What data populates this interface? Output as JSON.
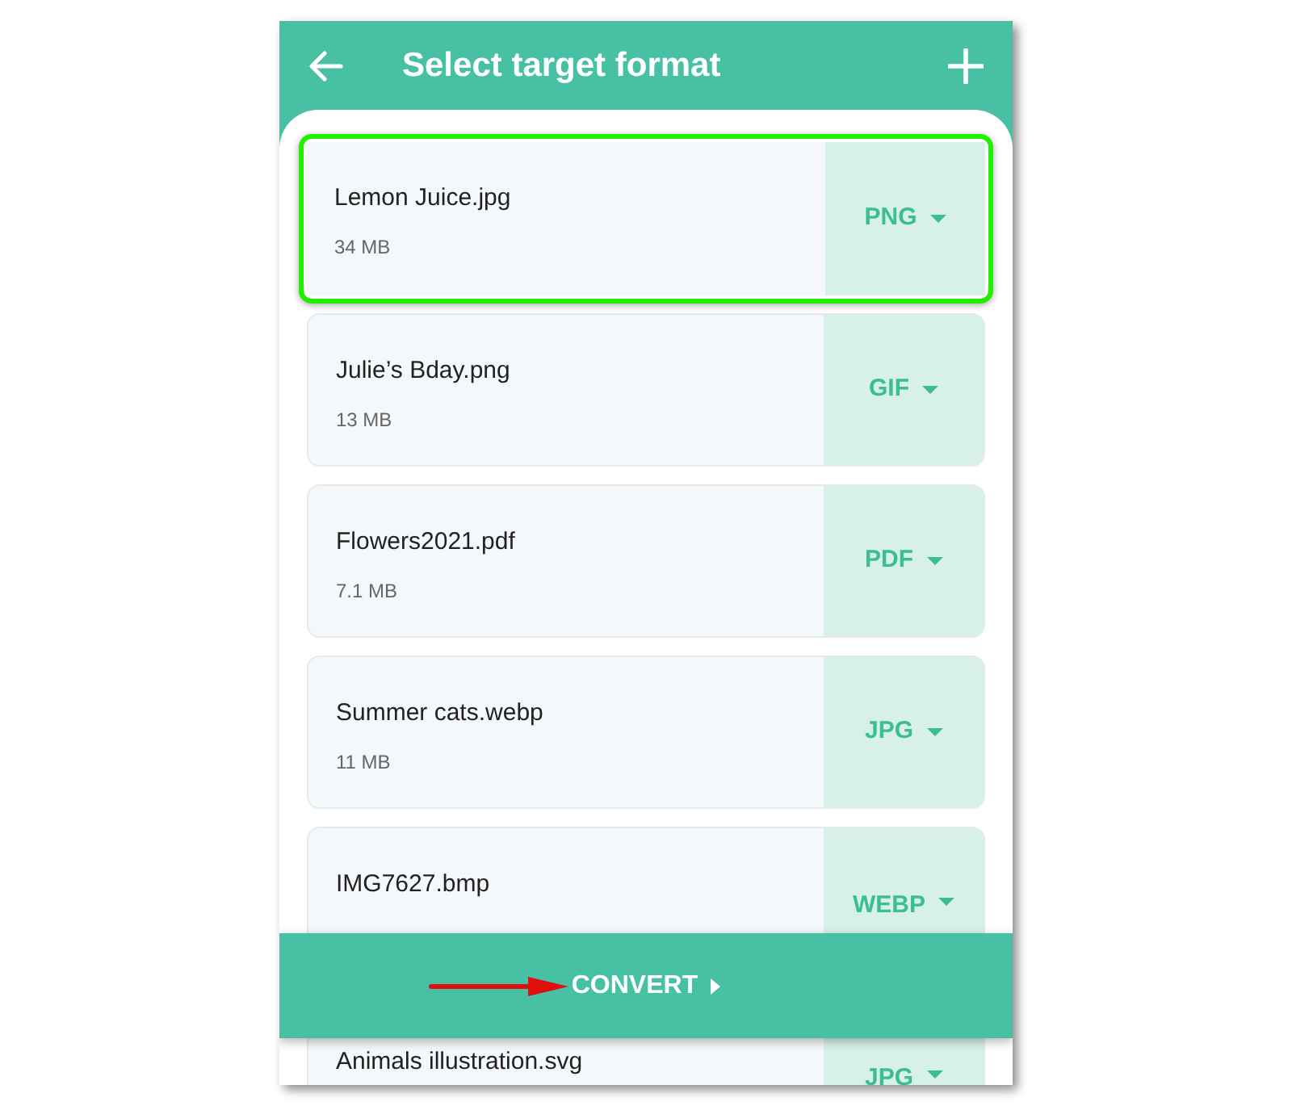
{
  "header": {
    "title": "Select target format"
  },
  "files": [
    {
      "name": "Lemon Juice.jpg",
      "size": "34 MB",
      "format": "PNG",
      "highlighted": true
    },
    {
      "name": "Julie’s Bday.png",
      "size": "13 MB",
      "format": "GIF",
      "highlighted": false
    },
    {
      "name": "Flowers2021.pdf",
      "size": "7.1 MB",
      "format": "PDF",
      "highlighted": false
    },
    {
      "name": "Summer cats.webp",
      "size": "11 MB",
      "format": "JPG",
      "highlighted": false
    },
    {
      "name": "IMG7627.bmp",
      "format": "WEBP",
      "highlighted": false
    },
    {
      "name": "Animals illustration.svg",
      "format": "JPG"
    }
  ],
  "convert_button": {
    "label": "CONVERT"
  }
}
